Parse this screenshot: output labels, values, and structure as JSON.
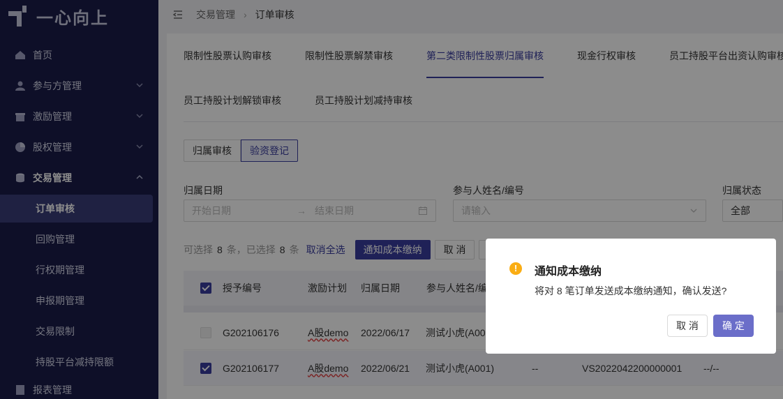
{
  "app": {
    "logo_text": "一心向上"
  },
  "sidebar": {
    "items": [
      {
        "label": "首页",
        "icon": "home-icon"
      },
      {
        "label": "参与方管理",
        "icon": "users-icon"
      },
      {
        "label": "激励管理",
        "icon": "gift-icon"
      },
      {
        "label": "股权管理",
        "icon": "pie-icon"
      },
      {
        "label": "交易管理",
        "icon": "coins-icon"
      }
    ],
    "sub_items": [
      "订单审核",
      "回购管理",
      "行权期管理",
      "申报期管理",
      "交易限制",
      "持股平台减持限额"
    ],
    "partial_item": "报表管理"
  },
  "breadcrumb": {
    "parent": "交易管理",
    "current": "订单审核"
  },
  "tabs_row1": [
    "限制性股票认购审核",
    "限制性股票解禁审核",
    "第二类限制性股票归属审核",
    "现金行权审核",
    "员工持股平台出资认购审核"
  ],
  "tabs_row2": [
    "员工持股计划解锁审核",
    "员工持股计划减持审核"
  ],
  "segment": {
    "left": "归属审核",
    "right": "验资登记"
  },
  "filters": {
    "date_label": "归属日期",
    "date_start_placeholder": "开始日期",
    "date_end_placeholder": "结束日期",
    "participant_label": "参与人姓名/编号",
    "participant_placeholder": "请输入",
    "status_label": "归属状态",
    "status_value": "全部"
  },
  "actionbar": {
    "selectable_prefix": "可选择",
    "selectable_count": "8",
    "selectable_suffix": "条，已选择",
    "selected_count": "8",
    "selected_suffix": "条",
    "cancel_all": "取消全选",
    "notify_button": "通知成本缴纳",
    "cancel_button": "取 消"
  },
  "table": {
    "headers": [
      "授予编号",
      "激励计划",
      "归属日期",
      "参与人姓名/编"
    ],
    "rows": [
      {
        "grant_no": "G202106176",
        "plan": "A股demo",
        "date": "2022/06/17",
        "participant": "测试小虎(A00",
        "c5": "",
        "c6": "",
        "c7": ""
      },
      {
        "grant_no": "G202106177",
        "plan": "A股demo",
        "date": "2022/06/21",
        "participant": "测试小虎(A001)",
        "c5": "--",
        "c6": "VS2022042200000001",
        "c7": "--/--"
      }
    ]
  },
  "modal": {
    "title": "通知成本缴纳",
    "message": "将对 8 笔订单发送成本缴纳通知，确认发送?",
    "cancel": "取 消",
    "ok": "确 定",
    "warn_glyph": "!"
  },
  "colors": {
    "sidebar_bg": "#1a1d4a",
    "primary": "#3a3d9e",
    "warning": "#faad14"
  }
}
